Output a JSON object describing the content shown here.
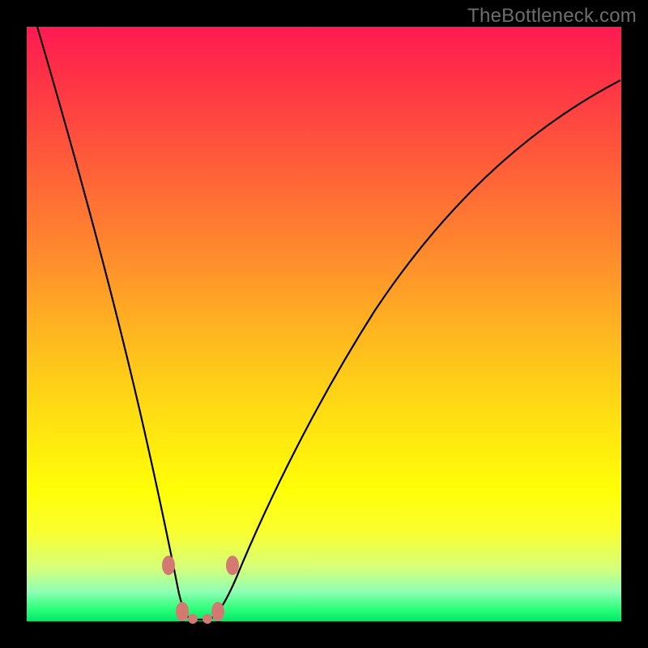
{
  "watermark": "TheBottleneck.com",
  "chart_data": {
    "type": "line",
    "title": "",
    "xlabel": "",
    "ylabel": "",
    "xlim": [
      0,
      100
    ],
    "ylim": [
      0,
      100
    ],
    "x": [
      0,
      3,
      6,
      9,
      12,
      15,
      18,
      20,
      22,
      23.5,
      25,
      26.5,
      28,
      30,
      32,
      35,
      39,
      44,
      50,
      57,
      65,
      73,
      81,
      89,
      96,
      100
    ],
    "values": [
      100,
      90,
      78,
      66,
      54,
      42,
      30,
      20,
      12,
      7,
      3,
      0,
      0,
      0,
      3,
      8,
      15,
      24,
      34,
      44,
      54,
      62,
      69,
      75,
      79,
      81
    ],
    "beads": [
      {
        "x": 22.5,
        "y": 10
      },
      {
        "x": 24.5,
        "y": 2
      },
      {
        "x": 31.3,
        "y": 2
      },
      {
        "x": 33.2,
        "y": 10
      }
    ],
    "gradient_stops": [
      {
        "pct": 100,
        "color": "#ff1a52"
      },
      {
        "pct": 86,
        "color": "#ff4a40"
      },
      {
        "pct": 62,
        "color": "#ff8a2d"
      },
      {
        "pct": 34,
        "color": "#ffe012"
      },
      {
        "pct": 15,
        "color": "#f9ff2f"
      },
      {
        "pct": 5,
        "color": "#8fffb4"
      },
      {
        "pct": 0,
        "color": "#00e86b"
      }
    ]
  }
}
